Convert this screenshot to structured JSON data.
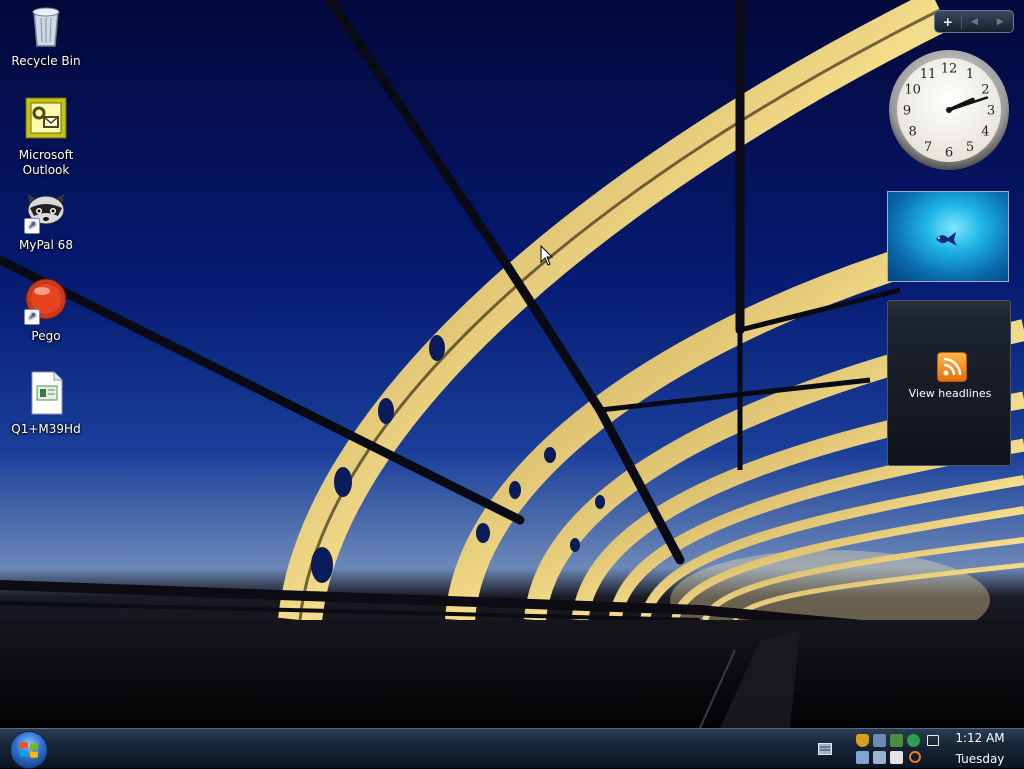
{
  "desktop": {
    "icons": [
      {
        "label": "Recycle Bin",
        "icon": "recycle-bin-icon",
        "shortcut": false
      },
      {
        "label": "Microsoft Outlook",
        "icon": "outlook-icon",
        "shortcut": false
      },
      {
        "label": "MyPal 68",
        "icon": "mypal-raccoon-icon",
        "shortcut": true
      },
      {
        "label": "Pego",
        "icon": "pego-red-orb-icon",
        "shortcut": true
      },
      {
        "label": "Q1+M39Hd",
        "icon": "document-file-icon",
        "shortcut": false
      }
    ]
  },
  "sidebar": {
    "controls": {
      "add": "+",
      "prev": "◀",
      "next": "▶"
    },
    "clock": {
      "hour": 2,
      "minute": 12,
      "numerals": [
        "12",
        "1",
        "2",
        "3",
        "4",
        "5",
        "6",
        "7",
        "8",
        "9",
        "10",
        "11"
      ]
    },
    "feed": {
      "label": "View headlines",
      "icon": "rss-feed-icon"
    },
    "slideshow": {
      "icon": "betta-fish-image"
    }
  },
  "taskbar": {
    "start_icon": "windows-start-orb",
    "tray_icons": [
      "defender-shield-icon",
      "network-icon",
      "security-center-icon",
      "update-check-icon",
      "action-center-flag-icon",
      "display-icon",
      "volume-icon",
      "keyboard-icon",
      "search-icon"
    ],
    "time": "1:12 AM",
    "day": "Tuesday"
  },
  "colors": {
    "sky_top": "#03083a",
    "sky_mid": "#1a3f9a",
    "bridge_light": "#f1d27a",
    "taskbar": "#162536",
    "rss_orange": "#f08a1c"
  }
}
